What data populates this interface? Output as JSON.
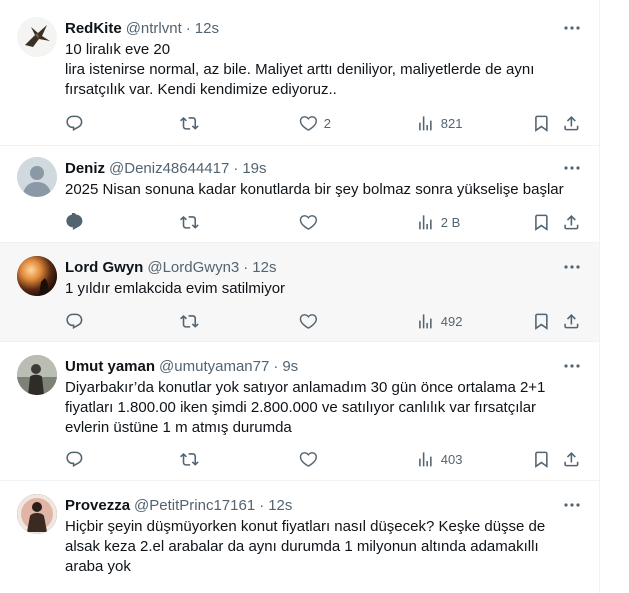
{
  "tweets": [
    {
      "name": "RedKite",
      "handle": "@ntrlvnt",
      "time": "12s",
      "text": "10 liralık eve 20\nlira istenirse normal, az bile. Maliyet arttı deniliyor, maliyetlerde de aynı fırsatçılık var. Kendi kendimize ediyoruz..",
      "likes": "2",
      "views": "821",
      "avatar_color": "#f2f2f2"
    },
    {
      "name": "Deniz",
      "handle": "@Deniz48644417",
      "time": "19s",
      "text": "2025 Nisan sonuna kadar konutlarda bir şey bolmaz sonra yükselişe başlar",
      "likes": "",
      "views": "2 B",
      "avatar_color": "#cfd9de"
    },
    {
      "name": "Lord Gwyn",
      "handle": "@LordGwyn3",
      "time": "12s",
      "text": "1 yıldır emlakcida evim satilmiyor",
      "likes": "",
      "views": "492",
      "avatar_color": "#3a2418"
    },
    {
      "name": "Umut yaman",
      "handle": "@umutyaman77",
      "time": "9s",
      "text": "Diyarbakır’da konutlar yok satıyor anlamadım 30 gün önce ortalama 2+1 fiyatları 1.800.00 iken şimdi 2.800.000 ve satılıyor canlılık var fırsatçılar evlerin üstüne 1 m atmış durumda",
      "likes": "",
      "views": "403",
      "avatar_color": "#8a8f85"
    },
    {
      "name": "Provezza",
      "handle": "@PetitPrinc17161",
      "time": "12s",
      "text": "Hiçbir şeyin düşmüyorken konut fiyatları nasıl düşecek? Keşke düşse de alsak keza 2.el arabalar da aynı durumda 1 milyonun altında adamakıllı araba yok",
      "likes": "",
      "views": "",
      "avatar_color": "#5a3a2a"
    }
  ],
  "colors": {
    "text_primary": "#0f1419",
    "text_secondary": "#536471",
    "divider": "#eff3f4",
    "hover_bg": "#f7f7f7"
  },
  "icons": {
    "reply": "reply-icon",
    "retweet": "retweet-icon",
    "like": "heart-icon",
    "views": "views-icon",
    "bookmark": "bookmark-icon",
    "share": "share-icon",
    "more": "more-icon"
  }
}
